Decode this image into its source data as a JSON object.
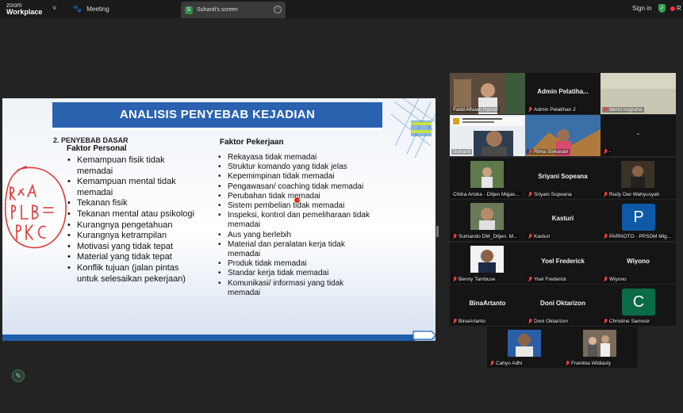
{
  "topbar": {
    "brand_line1": "zoom",
    "brand_line2": "Workplace",
    "brand_chevron": "˅",
    "meeting_icon": "paw-icon",
    "meeting_label": "Meeting",
    "screen_tab_badge": "S",
    "screen_tab_label": "Suhardi's screen",
    "screen_tab_more": "⋯",
    "signin_label": "Sign in",
    "record_label": "R"
  },
  "slide": {
    "title": "ANALISIS PENYEBAB KEJADIAN",
    "section": "2.   PENYEBAB DASAR",
    "left_heading": "Faktor Personal",
    "left_items": [
      "Kemampuan fisik tidak memadai",
      "Kemampuan mental tidak memadai",
      "Tekanan fisik",
      "Tekanan mental atau psikologi",
      "Kurangnya  pengetahuan",
      "Kurangnya ketrampilan",
      "Motivasi yang tidak tepat",
      "Material yang tidak tepat",
      "Konflik tujuan (jalan pintas untuk selesaikan pekerjaan)"
    ],
    "right_heading": "Faktor Pekerjaan",
    "right_items": [
      "Rekayasa tidak memadai",
      "Struktur komando yang tidak jelas",
      "Kepemimpinan tidak memadai",
      "Pengawasan/ coaching tidak memadai",
      "Perubahan tidak memadai",
      "Sistem pembelian tidak memadai",
      "Inspeksi, kontrol dan pemeliharaan tidak memadai",
      "Aus yang berlebih",
      "Material dan peralatan kerja tidak memadai",
      "Produk tidak memadai",
      "Standar kerja tidak memadai",
      "Komunikasi/ informasi yang tidak memadai"
    ]
  },
  "participants": [
    {
      "name": "Farid Alfalah Hamid",
      "display": "",
      "muted": false
    },
    {
      "name": "Admin Pelatihan 2",
      "display": "Admin  Pelatiha...",
      "muted": true
    },
    {
      "name": "denni nugraha",
      "display": "",
      "muted": true
    },
    {
      "name": "Suhardi",
      "display": "",
      "muted": false
    },
    {
      "name": "Rima Siskasari",
      "display": "",
      "muted": true
    },
    {
      "name": "-",
      "display": "-",
      "muted": true
    },
    {
      "name": "Chitra Ariska - Ditjen Migas...",
      "display": "",
      "muted": false
    },
    {
      "name": "Sriyani Sopeana",
      "display": "Sriyani Sopeana",
      "muted": true
    },
    {
      "name": "Rudy Dwi Wahyusyah",
      "display": "",
      "muted": true
    },
    {
      "name": "Sumando DM_Ditjen. M...",
      "display": "",
      "muted": true
    },
    {
      "name": "Kasturi",
      "display": "Kasturi",
      "muted": true
    },
    {
      "name": "PARNOTO - PPSDM Mig...",
      "display": "",
      "muted": true,
      "letter": "P"
    },
    {
      "name": "Benny Tambuse",
      "display": "",
      "muted": true
    },
    {
      "name": "Yoel Frederick",
      "display": "Yoel Frederick",
      "muted": true
    },
    {
      "name": "Wiyono",
      "display": "Wiyono",
      "muted": true
    },
    {
      "name": "BinaArtanto",
      "display": "BinaArtanto",
      "muted": true
    },
    {
      "name": "Doni Oktarizon",
      "display": "Doni Oktarizon",
      "muted": true
    },
    {
      "name": "Christine Samosir",
      "display": "",
      "muted": true,
      "letter": "C"
    },
    {
      "name": "Cahyo Adhi",
      "display": "",
      "muted": true
    },
    {
      "name": "Frambia Widiasty",
      "display": "",
      "muted": true
    }
  ],
  "colors": {
    "accent_green": "#2fae5e",
    "title_blue": "#2a62b0",
    "avatar_p": "#0e5aa7",
    "avatar_c": "#0b6b47",
    "mic_red": "#e04040",
    "pointer_red": "#e0321c"
  },
  "edit_icon_glyph": "✎"
}
